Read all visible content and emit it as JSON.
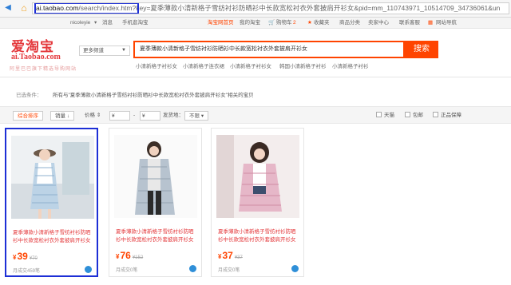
{
  "browser": {
    "url_host": "ai.taobao.com",
    "url_rest": "/search/index.htm?key=夏季薄款小清新格子雪纺衬衫防晒衫中长款宽松衬衣外套披肩开衫女&pid=mm_110743971_10514709_34736061&un"
  },
  "topnav": {
    "user": "nicoleyie",
    "messages": "消息",
    "mobile": "手机逛淘宝",
    "home": "淘宝网首页",
    "my_taobao": "我的淘宝",
    "cart": "购物车",
    "cart_count": "2",
    "favorites": "收藏夹",
    "products": "商品分类",
    "seller": "卖家中心",
    "contact": "联系客服",
    "site_nav": "网站导航"
  },
  "header": {
    "logo_main": "爱淘宝",
    "logo_sub": "ai.Taobao.com",
    "logo_slogan": "阿里巴巴旗下精选导购网站",
    "channel": "更多频道",
    "search_value": "夏季薄款小清新格子雪纺衬衫防晒衫中长款宽松衬衣外套披肩开衫女",
    "search_button": "搜索",
    "hot_keywords": [
      "小清新格子衬衫女",
      "小清新格子连衣裙",
      "小清新格子衬衫女",
      "韩国小清新格子衬衫",
      "小清新格子衬衫"
    ]
  },
  "breadcrumb": {
    "label": "已选条件：",
    "text": "所有与\"夏季薄款小清新格子雪纺衬衫防晒衫中长款宽松衬衣外套披肩开衫女\"相关的宝贝"
  },
  "filters": {
    "sort_default": "综合排序",
    "sort_sales": "销量",
    "sort_price": "价格",
    "price_from": "¥",
    "price_sep": "-",
    "price_to": "¥",
    "ship_from_label": "发货地：",
    "ship_from_value": "不限",
    "opt_tmall": "天猫",
    "opt_freeship": "包邮",
    "opt_genuine": "正品保障"
  },
  "products": [
    {
      "title": "夏季薄款小清新格子雪纺衬衫防晒衫中长款宽松衬衣外套披肩开衫女",
      "price": "39",
      "orig_price": "¥70",
      "sales": "月成交459笔"
    },
    {
      "title": "夏季薄款小清新格子雪纺衬衫防晒衫中长款宽松衬衣外套披肩开衫女",
      "price": "76",
      "orig_price": "¥152",
      "sales": "月成交0笔"
    },
    {
      "title": "夏季薄款小清新格子雪纺衬衫防晒衫中长款宽松衬衣外套披肩开衫女",
      "price": "37",
      "orig_price": "¥37",
      "sales": "月成交0笔"
    }
  ],
  "colors": {
    "brand": "#ff4400",
    "logo": "#e4393c",
    "highlight": "#1d2fd6"
  }
}
